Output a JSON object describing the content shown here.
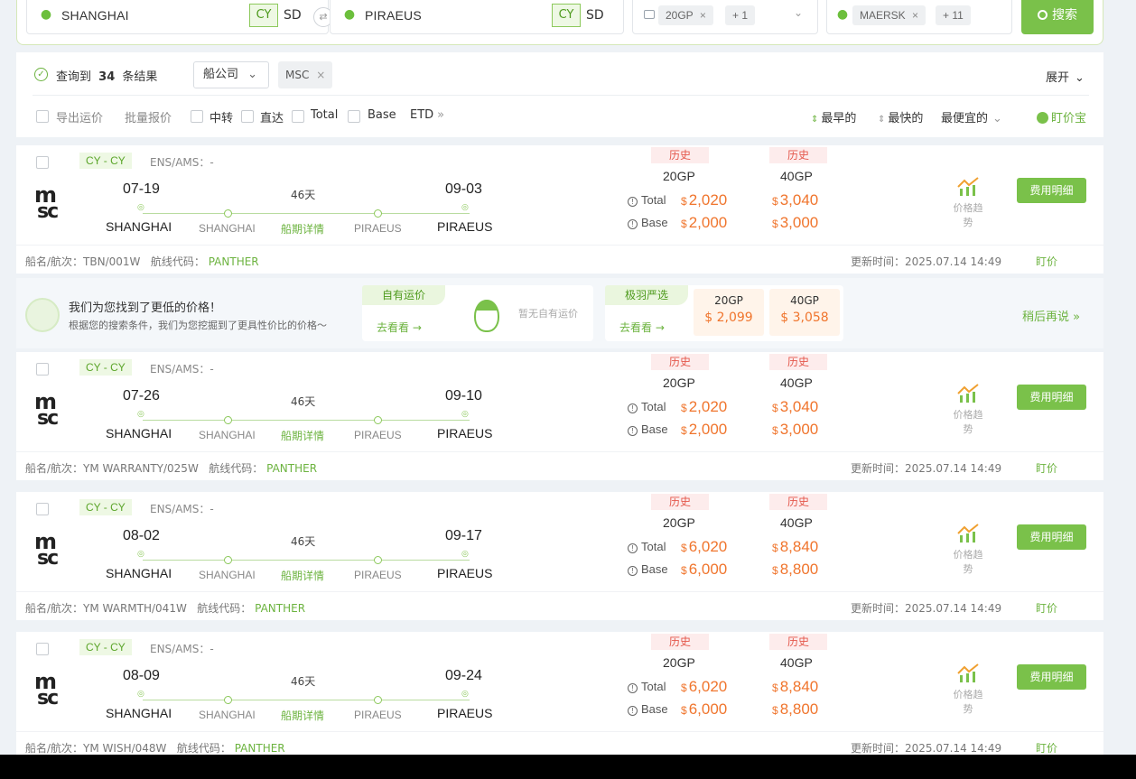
{
  "search": {
    "origin": "SHANGHAI",
    "origin_mode": "CY",
    "origin_alt": "SD",
    "dest": "PIRAEUS",
    "dest_mode": "CY",
    "dest_alt": "SD",
    "container": "20GP",
    "container_more": "+ 1",
    "carrier": "MAERSK",
    "carrier_more": "+ 11",
    "button": "搜索"
  },
  "results": {
    "prefix": "查询到",
    "count": "34",
    "suffix": "条结果",
    "carrier_filter": "船公司",
    "carrier_tag": "MSC",
    "expand": "展开"
  },
  "filters": {
    "export": "导出运价",
    "batch": "批量报价",
    "transfer": "中转",
    "direct": "直达",
    "total": "Total",
    "base": "Base",
    "etd": "ETD",
    "sort_earliest": "最早的",
    "sort_fastest": "最快的",
    "sort_cheapest": "最便宜的",
    "price_lock": "盯价宝"
  },
  "card_labels": {
    "cy": "CY - CY",
    "ens": "ENS/AMS：-",
    "hist": "历史",
    "c20": "20GP",
    "c40": "40GP",
    "total": "Total",
    "base": "Base",
    "trend": "价格趋势",
    "detail_btn": "费用明细",
    "ship_detail": "船期详情",
    "vessel_prefix": "船名/航次：",
    "route_prefix": "航线代码：",
    "update_prefix": "更新时间：",
    "watch": "盯价",
    "currency": "$",
    "duration": "46天"
  },
  "cards": [
    {
      "etd": "07-19",
      "eta": "09-03",
      "pol": "SHANGHAI",
      "pol_small": "SHANGHAI",
      "pod_small": "PIRAEUS",
      "pod": "PIRAEUS",
      "total20": "2,020",
      "total40": "3,040",
      "base20": "2,000",
      "base40": "3,000",
      "vessel": "TBN/001W",
      "route": "PANTHER",
      "updated": "2025.07.14 14:49"
    },
    {
      "etd": "07-26",
      "eta": "09-10",
      "pol": "SHANGHAI",
      "pol_small": "SHANGHAI",
      "pod_small": "PIRAEUS",
      "pod": "PIRAEUS",
      "total20": "2,020",
      "total40": "3,040",
      "base20": "2,000",
      "base40": "3,000",
      "vessel": "YM WARRANTY/025W",
      "route": "PANTHER",
      "updated": "2025.07.14 14:49"
    },
    {
      "etd": "08-02",
      "eta": "09-17",
      "pol": "SHANGHAI",
      "pol_small": "SHANGHAI",
      "pod_small": "PIRAEUS",
      "pod": "PIRAEUS",
      "total20": "6,020",
      "total40": "8,840",
      "base20": "6,000",
      "base40": "8,800",
      "vessel": "YM WARMTH/041W",
      "route": "PANTHER",
      "updated": "2025.07.14 14:49"
    },
    {
      "etd": "08-09",
      "eta": "09-24",
      "pol": "SHANGHAI",
      "pol_small": "SHANGHAI",
      "pod_small": "PIRAEUS",
      "pod": "PIRAEUS",
      "total20": "6,020",
      "total40": "8,840",
      "base20": "6,000",
      "base40": "8,800",
      "vessel": "YM WISH/048W",
      "route": "PANTHER",
      "updated": "2025.07.14 14:49"
    }
  ],
  "promo": {
    "title": "我们为您找到了更低的价格！",
    "subtitle": "根据您的搜索条件，我们为您挖掘到了更具性价比的价格～",
    "own_tag": "自有运价",
    "own_link": "去看看 →",
    "own_empty": "暂无自有运价",
    "select_tag": "极羽严选",
    "select_link": "去看看 →",
    "select_c20": "20GP",
    "select_c40": "40GP",
    "select_p20": "$ 2,099",
    "select_p40": "$ 3,058",
    "later": "稍后再说 »"
  },
  "colors": {
    "accent": "#7ac14a",
    "price": "#f0752d",
    "history": "#e4574b"
  }
}
